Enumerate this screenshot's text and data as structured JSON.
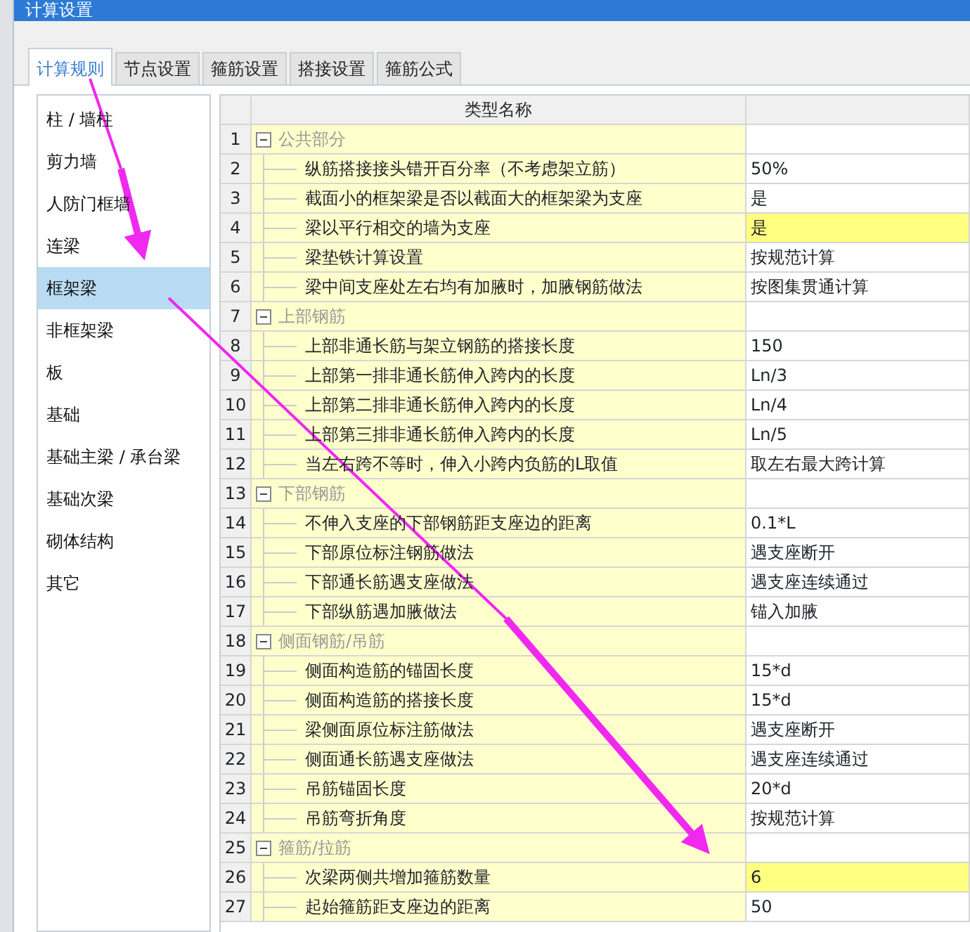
{
  "window": {
    "title": "计算设置"
  },
  "tabs": [
    {
      "label": "计算规则",
      "selected": true
    },
    {
      "label": "节点设置",
      "selected": false
    },
    {
      "label": "箍筋设置",
      "selected": false
    },
    {
      "label": "搭接设置",
      "selected": false
    },
    {
      "label": "箍筋公式",
      "selected": false
    }
  ],
  "sidebar": {
    "items": [
      {
        "label": "柱 / 墙柱",
        "selected": false
      },
      {
        "label": "剪力墙",
        "selected": false
      },
      {
        "label": "人防门框墙",
        "selected": false
      },
      {
        "label": "连梁",
        "selected": false
      },
      {
        "label": "框架梁",
        "selected": true
      },
      {
        "label": "非框架梁",
        "selected": false
      },
      {
        "label": "板",
        "selected": false
      },
      {
        "label": "基础",
        "selected": false
      },
      {
        "label": "基础主梁 / 承台梁",
        "selected": false
      },
      {
        "label": "基础次梁",
        "selected": false
      },
      {
        "label": "砌体结构",
        "selected": false
      },
      {
        "label": "其它",
        "selected": false
      }
    ]
  },
  "table": {
    "columns": [
      "类型名称"
    ],
    "rows": [
      {
        "number": "1",
        "kind": "group",
        "expanded": true,
        "name": "公共部分"
      },
      {
        "number": "2",
        "kind": "item",
        "name": "纵筋搭接接头错开百分率（不考虑架立筋）",
        "value": "50%",
        "highlighted": false
      },
      {
        "number": "3",
        "kind": "item",
        "name": "截面小的框架梁是否以截面大的框架梁为支座",
        "value": "是",
        "highlighted": false
      },
      {
        "number": "4",
        "kind": "item",
        "name": "梁以平行相交的墙为支座",
        "value": "是",
        "highlighted": true
      },
      {
        "number": "5",
        "kind": "item",
        "name": "梁垫铁计算设置",
        "value": "按规范计算",
        "highlighted": false
      },
      {
        "number": "6",
        "kind": "item",
        "name": "梁中间支座处左右均有加腋时，加腋钢筋做法",
        "value": "按图集贯通计算",
        "highlighted": false
      },
      {
        "number": "7",
        "kind": "group",
        "expanded": true,
        "name": "上部钢筋"
      },
      {
        "number": "8",
        "kind": "item",
        "name": "上部非通长筋与架立钢筋的搭接长度",
        "value": "150",
        "highlighted": false
      },
      {
        "number": "9",
        "kind": "item",
        "name": "上部第一排非通长筋伸入跨内的长度",
        "value": "Ln/3",
        "highlighted": false
      },
      {
        "number": "10",
        "kind": "item",
        "name": "上部第二排非通长筋伸入跨内的长度",
        "value": "Ln/4",
        "highlighted": false
      },
      {
        "number": "11",
        "kind": "item",
        "name": "上部第三排非通长筋伸入跨内的长度",
        "value": "Ln/5",
        "highlighted": false
      },
      {
        "number": "12",
        "kind": "item",
        "name": "当左右跨不等时，伸入小跨内负筋的L取值",
        "value": "取左右最大跨计算",
        "highlighted": false
      },
      {
        "number": "13",
        "kind": "group",
        "expanded": true,
        "name": "下部钢筋"
      },
      {
        "number": "14",
        "kind": "item",
        "name": "不伸入支座的下部钢筋距支座边的距离",
        "value": "0.1*L",
        "highlighted": false
      },
      {
        "number": "15",
        "kind": "item",
        "name": "下部原位标注钢筋做法",
        "value": "遇支座断开",
        "highlighted": false
      },
      {
        "number": "16",
        "kind": "item",
        "name": "下部通长筋遇支座做法",
        "value": "遇支座连续通过",
        "highlighted": false
      },
      {
        "number": "17",
        "kind": "item",
        "name": "下部纵筋遇加腋做法",
        "value": "锚入加腋",
        "highlighted": false
      },
      {
        "number": "18",
        "kind": "group",
        "expanded": true,
        "name": "侧面钢筋/吊筋"
      },
      {
        "number": "19",
        "kind": "item",
        "name": "侧面构造筋的锚固长度",
        "value": "15*d",
        "highlighted": false
      },
      {
        "number": "20",
        "kind": "item",
        "name": "侧面构造筋的搭接长度",
        "value": "15*d",
        "highlighted": false
      },
      {
        "number": "21",
        "kind": "item",
        "name": "梁侧面原位标注筋做法",
        "value": "遇支座断开",
        "highlighted": false
      },
      {
        "number": "22",
        "kind": "item",
        "name": "侧面通长筋遇支座做法",
        "value": "遇支座连续通过",
        "highlighted": false
      },
      {
        "number": "23",
        "kind": "item",
        "name": "吊筋锚固长度",
        "value": "20*d",
        "highlighted": false
      },
      {
        "number": "24",
        "kind": "item",
        "name": "吊筋弯折角度",
        "value": "按规范计算",
        "highlighted": false
      },
      {
        "number": "25",
        "kind": "group",
        "expanded": true,
        "name": "箍筋/拉筋"
      },
      {
        "number": "26",
        "kind": "item",
        "name": "次梁两侧共增加箍筋数量",
        "value": "6",
        "highlighted": true
      },
      {
        "number": "27",
        "kind": "item",
        "name": "起始箍筋距支座边的距离",
        "value": "50",
        "highlighted": false
      }
    ]
  }
}
